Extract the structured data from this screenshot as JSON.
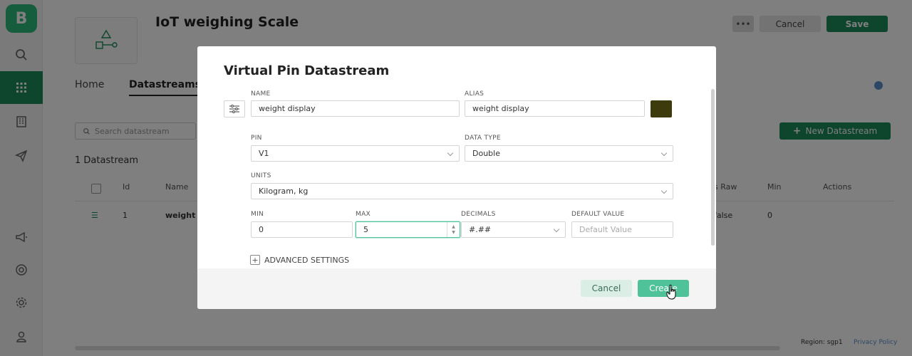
{
  "app": {
    "logo_letter": "B",
    "title": "IoT weighing Scale",
    "more_label": "•••",
    "cancel_label": "Cancel",
    "save_label": "Save",
    "tabs": [
      "Home",
      "Datastreams"
    ],
    "search_placeholder": "Search datastream",
    "new_datastream_label": "New Datastream",
    "datastream_count": "1 Datastream",
    "table": {
      "headers": [
        "Id",
        "Name",
        "s Raw",
        "Min",
        "Actions"
      ],
      "row": {
        "id": "1",
        "name": "weight",
        "is_raw": "false",
        "min": "0"
      }
    },
    "region": "Region: sgp1",
    "privacy": "Privacy Policy"
  },
  "modal": {
    "title": "Virtual Pin Datastream",
    "name": {
      "label": "NAME",
      "value": "weight display"
    },
    "alias": {
      "label": "ALIAS",
      "value": "weight display"
    },
    "color": "#3d3a0c",
    "pin": {
      "label": "PIN",
      "value": "V1"
    },
    "data_type": {
      "label": "DATA TYPE",
      "value": "Double"
    },
    "units": {
      "label": "UNITS",
      "value": "Kilogram, kg"
    },
    "min": {
      "label": "MIN",
      "value": "0"
    },
    "max": {
      "label": "MAX",
      "value": "5"
    },
    "decimals": {
      "label": "DECIMALS",
      "value": "#.##"
    },
    "default_value": {
      "label": "DEFAULT VALUE",
      "placeholder": "Default Value"
    },
    "advanced_label": "ADVANCED SETTINGS",
    "cancel_label": "Cancel",
    "create_label": "Create"
  },
  "colors": {
    "brand": "#2dbb7b",
    "dark_green": "#1a8a5a",
    "create": "#4fc29a"
  }
}
